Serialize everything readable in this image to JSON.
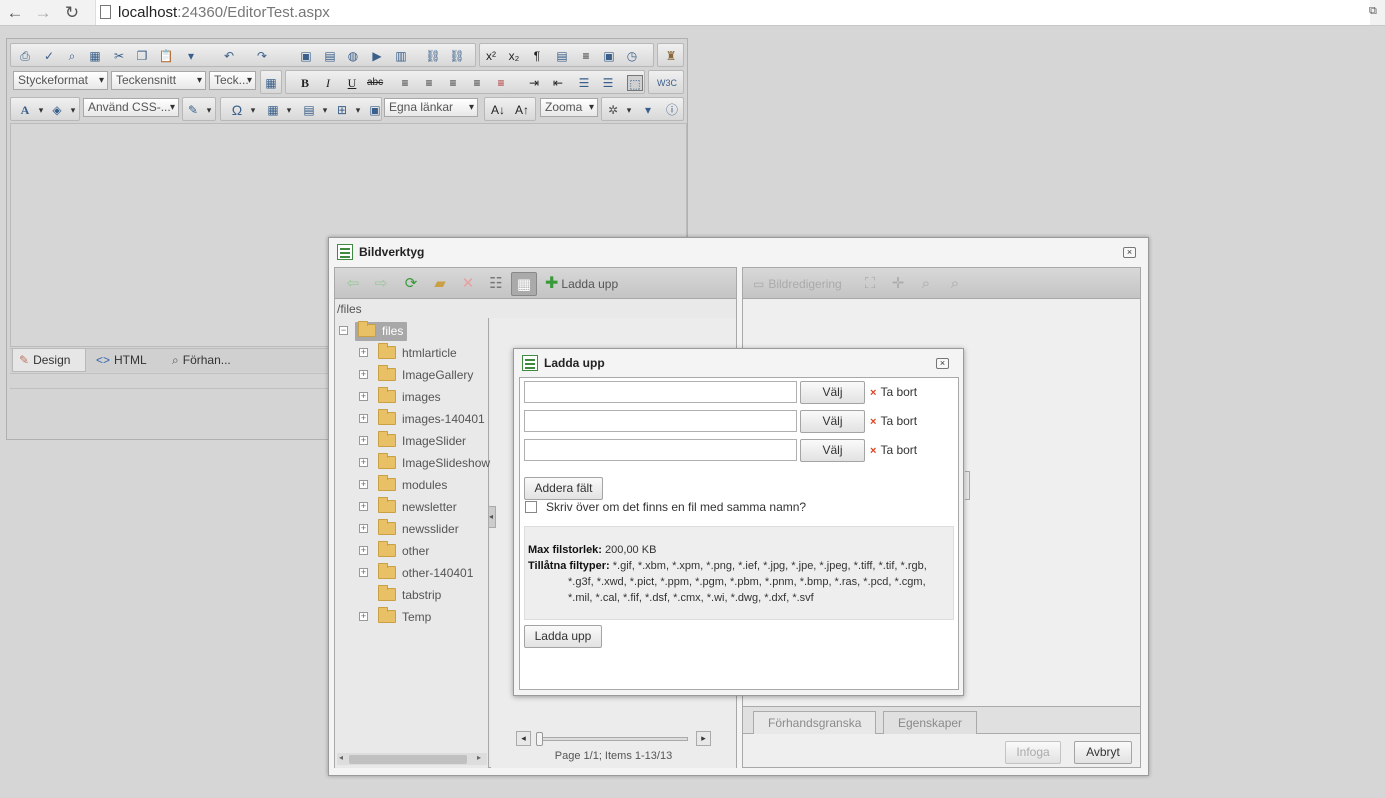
{
  "browser": {
    "url_host": "localhost",
    "url_rest": ":24360/EditorTest.aspx",
    "back_icon": "back-arrow-icon",
    "forward_icon": "forward-arrow-icon",
    "reload_icon": "reload-icon"
  },
  "editor": {
    "toolbar": {
      "paragraph_format": "Styckeformat",
      "font_name": "Teckensnitt",
      "font_size": "Teck...",
      "css_class": "Använd CSS-...",
      "custom_links": "Egna länkar",
      "zoom": "Zooma"
    },
    "mode_tabs": [
      {
        "label": "Design",
        "icon": "pencil-icon"
      },
      {
        "label": "HTML",
        "icon": "code-icon"
      },
      {
        "label": "Förhan...",
        "icon": "magnifier-icon"
      }
    ]
  },
  "image_manager": {
    "title": "Bildverktyg",
    "toolbar": {
      "upload_label": "Ladda upp"
    },
    "path": "/files",
    "tree": {
      "root": "files",
      "folders": [
        "htmlarticle",
        "ImageGallery",
        "images",
        "images-140401",
        "ImageSlider",
        "ImageSlideshow",
        "modules",
        "newsletter",
        "newsslider",
        "other",
        "other-140401",
        "tabstrip",
        "Temp"
      ]
    },
    "pager": "Page 1/1; Items 1-13/13",
    "right_toolbar": {
      "image_editing": "Bildredigering"
    },
    "preview_tabs": [
      "Förhandsgranska",
      "Egenskaper"
    ],
    "insert_button": "Infoga",
    "cancel_button": "Avbryt"
  },
  "upload_dialog": {
    "title": "Ladda upp",
    "rows": [
      {
        "value": "",
        "choose_label": "Välj",
        "remove_label": "Ta bort"
      },
      {
        "value": "",
        "choose_label": "Välj",
        "remove_label": "Ta bort"
      },
      {
        "value": "",
        "choose_label": "Välj",
        "remove_label": "Ta bort"
      }
    ],
    "add_field_label": "Addera fält",
    "overwrite_label": "Skriv över om det finns en fil med samma namn?",
    "overwrite_checked": false,
    "max_size_label": "Max filstorlek:",
    "max_size_value": "200,00 KB",
    "allowed_types_label": "Tillåtna filtyper:",
    "allowed_types_value": "*.gif, *.xbm, *.xpm, *.png, *.ief, *.jpg, *.jpe, *.jpeg, *.tiff, *.tif, *.rgb, *.g3f, *.xwd, *.pict, *.ppm, *.pgm, *.pbm, *.pnm, *.bmp, *.ras, *.pcd, *.cgm, *.mil, *.cal, *.fif, *.dsf, *.cmx, *.wi, *.dwg, *.dxf, *.svf",
    "upload_button": "Ladda upp"
  }
}
